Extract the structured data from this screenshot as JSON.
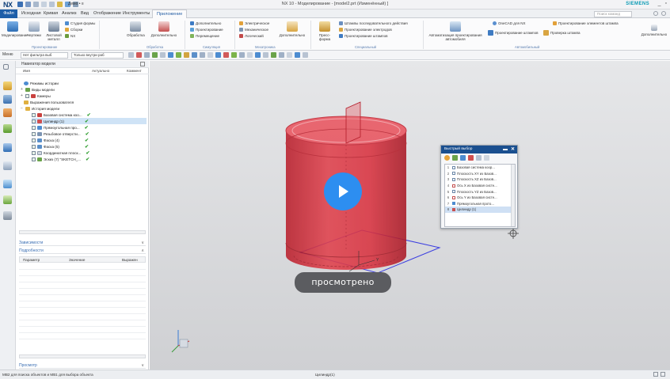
{
  "app": {
    "logo": "NX",
    "window_title": "NX 10 - Моделирование - [model2.prt (Изменённый) ]",
    "brand": "SIEMENS",
    "file_menu": "Демо • ≡"
  },
  "menu_tabs": [
    "Файл",
    "Исходная",
    "Кривая",
    "Анализ",
    "Вид",
    "Отображение",
    "Инструменты",
    "Приложение"
  ],
  "search_placeholder": "Поиск команд",
  "ribbon": {
    "modeling": [
      "Моделирование",
      "Чертежи",
      "Листовой металл"
    ],
    "flat": [
      "Студия формы",
      "Сборки",
      "NX"
    ],
    "group_design": "Проектирование",
    "processing": [
      "Обработка",
      "Дополнительно"
    ],
    "group_processing": "Обработка",
    "simulation": [
      "Дополнительно",
      "Проектирование",
      "Перемещение"
    ],
    "group_simulation": "Симуляция",
    "electrical": [
      "Электрическое",
      "Механическое",
      "Логический",
      "Дополнительно"
    ],
    "group_electrical": "Мехатроника",
    "press": [
      "Пресс-форма",
      "Штампы последовательного действия",
      "Проектирование электродов",
      "Проектирование штампов"
    ],
    "group_special": "Специальный",
    "automation": [
      "Автоматизация проектирования автомобиля",
      "Проектирование штампов",
      "Проверка штампа"
    ],
    "group_auto": "Автомобильный",
    "onecad": [
      "OneCAD для NX",
      "Проектирование элементов штампа",
      "Дополнительно"
    ]
  },
  "toolbar2": {
    "menu": "Меню",
    "filter": "Нет фильтра выб",
    "scope": "Только внутри раб"
  },
  "navigator": {
    "title": "Навигатор модели",
    "columns": [
      "Имя",
      "Актуально",
      "Коммент"
    ],
    "items": [
      {
        "label": "Режимы истории",
        "indent": 1
      },
      {
        "label": "Виды модели",
        "indent": 1
      },
      {
        "label": "Камеры",
        "indent": 1
      },
      {
        "label": "Выражения пользователя",
        "indent": 1
      },
      {
        "label": "История модели",
        "indent": 1
      },
      {
        "label": "Базовая система коо...",
        "indent": 2,
        "check": "✔"
      },
      {
        "label": "Цилиндр (1)",
        "indent": 2,
        "check": "✔",
        "selected": true
      },
      {
        "label": "Прямоугольная про...",
        "indent": 2,
        "check": "✔"
      },
      {
        "label": "Резьбовое отверсти...",
        "indent": 2,
        "check": "✔"
      },
      {
        "label": "Фаска (4)",
        "indent": 2,
        "check": "✔"
      },
      {
        "label": "Фаска (5)",
        "indent": 2,
        "check": "✔"
      },
      {
        "label": "Координатная плоск...",
        "indent": 2,
        "check": "✔"
      },
      {
        "label": "Эскиз (7) \"SKETCH_...",
        "indent": 2,
        "check": "✔"
      }
    ],
    "sections": [
      "Зависимости",
      "Подробности",
      "Просмотр"
    ],
    "prop_columns": [
      "Параметр",
      "Значение",
      "Выражен"
    ]
  },
  "quick_pick": {
    "title": "Быстрый выбор",
    "items": [
      {
        "n": "1",
        "label": "Базовая система коор..."
      },
      {
        "n": "2",
        "label": "Плоскость XY из Базов..."
      },
      {
        "n": "3",
        "label": "Плоскость XZ из Базов..."
      },
      {
        "n": "4",
        "label": "Ось X из Базовая систе..."
      },
      {
        "n": "5",
        "label": "Плоскость YZ из Базов..."
      },
      {
        "n": "6",
        "label": "Ось Y из Базовая систе..."
      },
      {
        "n": "7",
        "label": "Прямоугольная прото..."
      },
      {
        "n": "8",
        "label": "Цилиндр (1)"
      }
    ]
  },
  "overlay": {
    "watched_label": "просмотрено"
  },
  "status": {
    "left": "MB2 для поиска объектов и MB1 для выбора объекта",
    "center": "Цилиндр(1)"
  },
  "colors": {
    "cylinder": "#d8303c",
    "accent": "#1d5ea8",
    "play": "#2d8ef0"
  }
}
